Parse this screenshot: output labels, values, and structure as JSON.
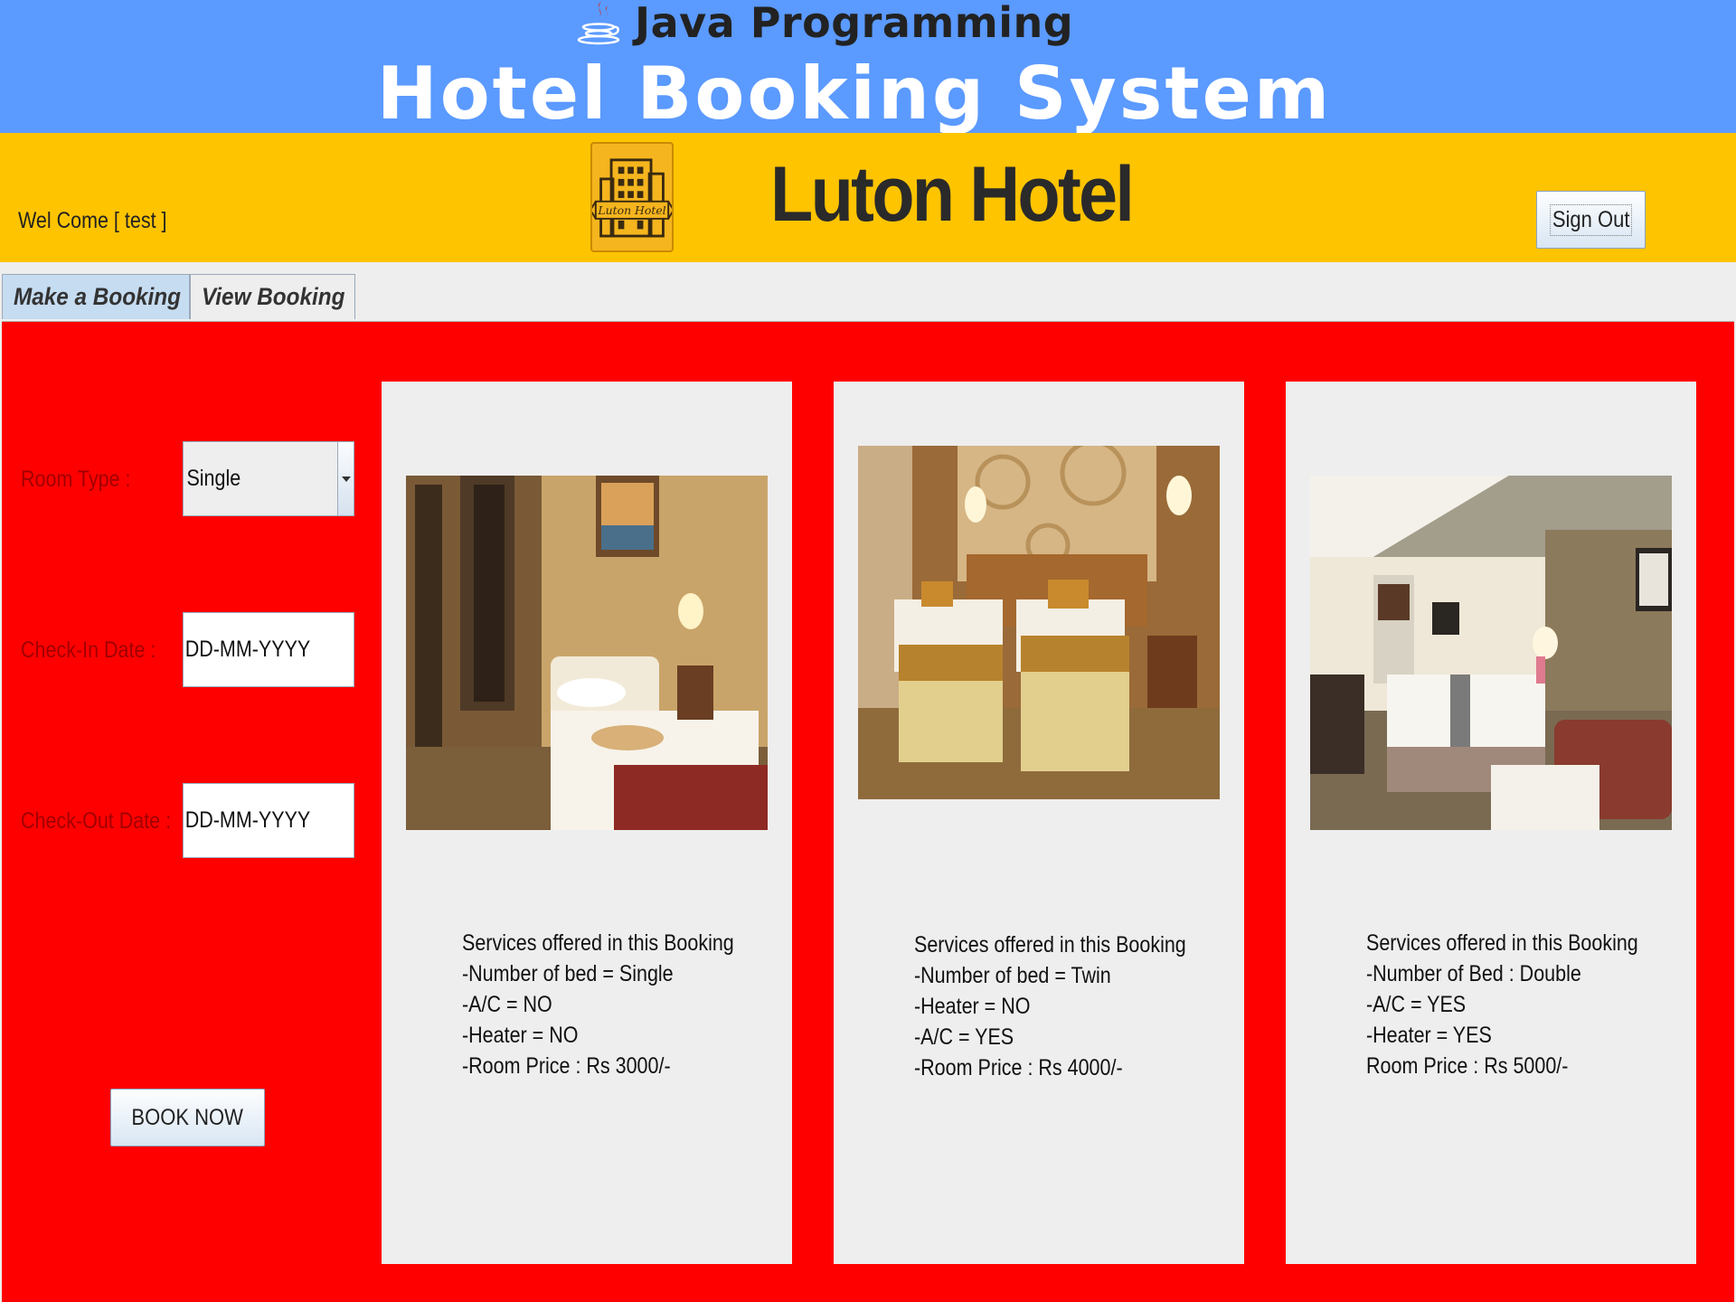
{
  "banner": {
    "java_title": "Java Programming",
    "system_title": "Hotel Booking System"
  },
  "hotel_bar": {
    "welcome": "Wel Come [ test ]",
    "logo_text": "Luton Hotel",
    "hotel_name": "Luton Hotel",
    "sign_out_label": "Sign Out"
  },
  "tabs": [
    {
      "label": "Make a Booking",
      "active": true
    },
    {
      "label": "View Booking",
      "active": false
    }
  ],
  "form": {
    "room_type_label": "Room Type :",
    "room_type_value": "Single",
    "check_in_label": "Check-In Date :",
    "check_in_value": "DD-MM-YYYY",
    "check_out_label": "Check-Out Date :",
    "check_out_value": "DD-MM-YYYY",
    "book_now_label": "BOOK NOW"
  },
  "rooms": [
    {
      "image": "single-room-photo",
      "services": [
        "Services offered in this Booking",
        "-Number of bed = Single",
        "-A/C = NO",
        "-Heater = NO",
        "-Room Price : Rs 3000/-"
      ]
    },
    {
      "image": "twin-room-photo",
      "services": [
        "Services offered in this Booking",
        "-Number of bed = Twin",
        "-Heater = NO",
        "-A/C = YES",
        "-Room Price : Rs 4000/-"
      ]
    },
    {
      "image": "double-room-photo",
      "services": [
        "Services offered in this Booking",
        "-Number of Bed : Double",
        "-A/C = YES",
        "-Heater = YES",
        "Room Price : Rs 5000/-"
      ]
    }
  ],
  "colors": {
    "banner_blue": "#5b9aff",
    "hotel_bar_yellow": "#ffc400",
    "content_red": "#ff0000",
    "card_gray": "#eeeeee",
    "label_dark_red": "#a10000"
  }
}
